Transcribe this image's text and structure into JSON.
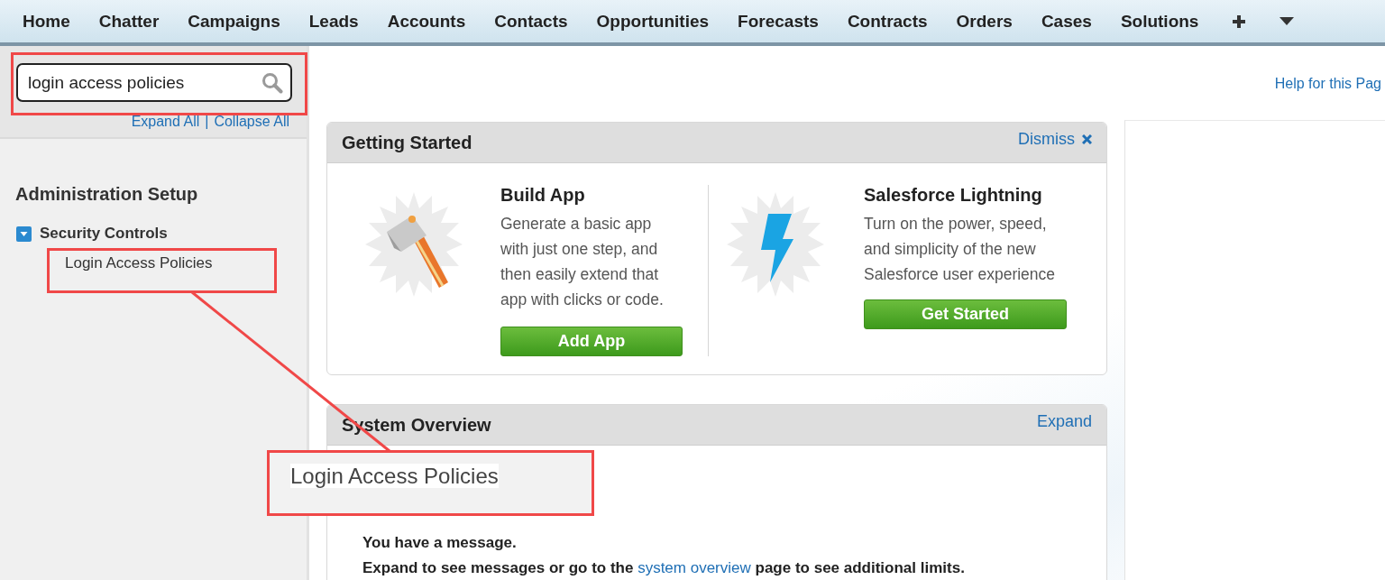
{
  "nav_tabs": [
    {
      "label": "Home"
    },
    {
      "label": "Chatter"
    },
    {
      "label": "Campaigns"
    },
    {
      "label": "Leads"
    },
    {
      "label": "Accounts"
    },
    {
      "label": "Contacts"
    },
    {
      "label": "Opportunities"
    },
    {
      "label": "Forecasts"
    },
    {
      "label": "Contracts"
    },
    {
      "label": "Orders"
    },
    {
      "label": "Cases"
    },
    {
      "label": "Solutions"
    }
  ],
  "search": {
    "value": "login access policies"
  },
  "tree_links": {
    "expand": "Expand All",
    "separator": "|",
    "collapse": "Collapse All"
  },
  "sidebar": {
    "heading": "Administration Setup",
    "tree": [
      {
        "label": "Security Controls",
        "expanded": true,
        "children": [
          {
            "label": "Login Access Policies"
          }
        ]
      }
    ]
  },
  "help_link": "Help for this Pag",
  "getting_started": {
    "title": "Getting Started",
    "dismiss": "Dismiss",
    "items": [
      {
        "kind": "build",
        "title": "Build App",
        "description": "Generate a basic app with just one step, and then easily extend that app with clicks or code.",
        "button": "Add App"
      },
      {
        "kind": "lightning",
        "title": "Salesforce Lightning",
        "description": "Turn on the power, speed, and simplicity of the new Salesforce user experience",
        "button": "Get Started"
      }
    ]
  },
  "system_overview": {
    "title": "System Overview",
    "expand": "Expand",
    "message_title": "You have a message.",
    "message_before": "Expand to see messages or go to the ",
    "message_link": "system overview",
    "message_after": " page to see additional limits."
  },
  "callout": {
    "text": "Login Access Policies"
  }
}
